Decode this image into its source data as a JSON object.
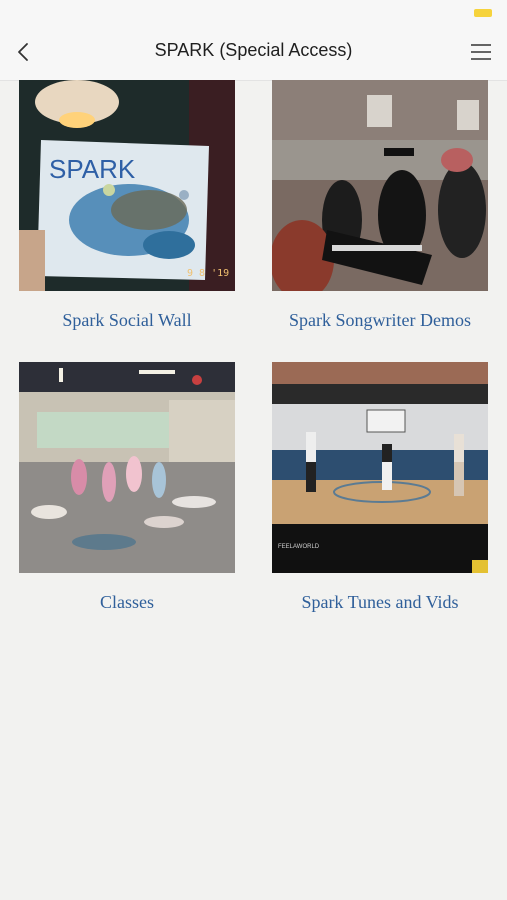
{
  "header": {
    "title": "SPARK (Special Access)"
  },
  "icons": {
    "back": "chevron-left-icon",
    "menu": "hamburger-menu-icon"
  },
  "colors": {
    "link": "#2f5f9a",
    "battery": "#f6d33c",
    "background": "#f2f2f0"
  },
  "tiles": [
    {
      "label": "Spark Social Wall",
      "image_text": "SPARK",
      "image_date": "9 8 '19"
    },
    {
      "label": "Spark Songwriter Demos"
    },
    {
      "label": "Classes"
    },
    {
      "label": "Spark Tunes and Vids",
      "image_caption": "FEELAWORLD"
    }
  ]
}
